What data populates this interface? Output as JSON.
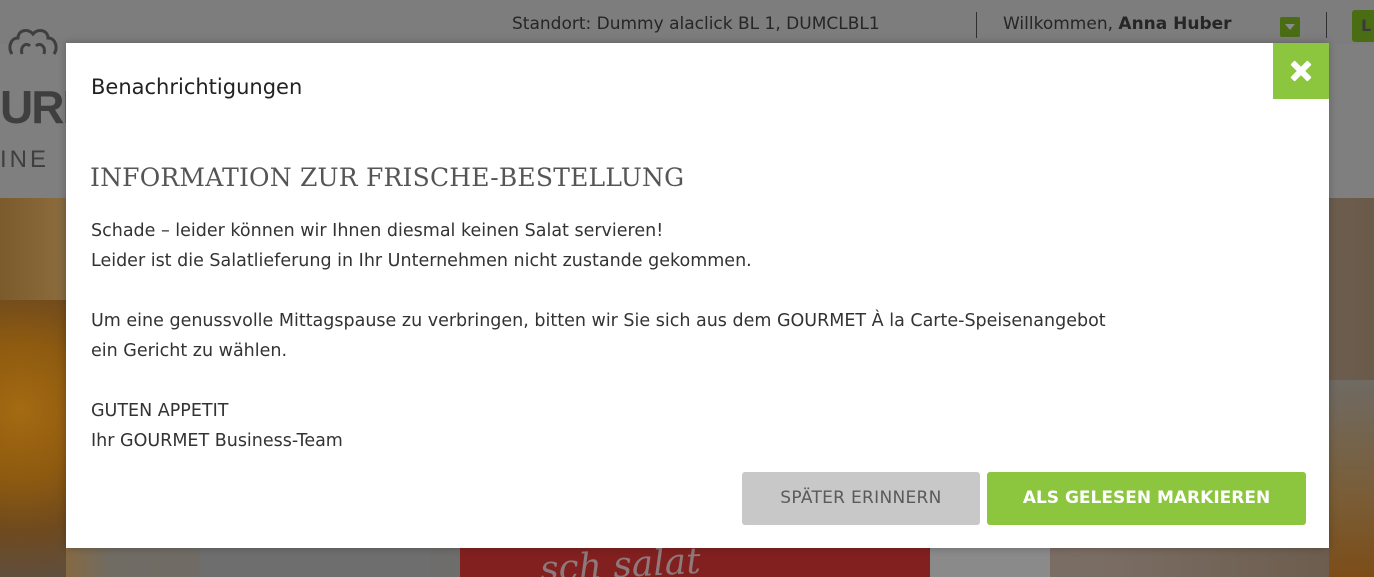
{
  "header": {
    "location": "Standort: Dummy alaclick BL 1, DUMCLBL1",
    "welcome_prefix": "Willkommen, ",
    "user_name": "Anna Huber",
    "right_button_label": "L"
  },
  "logo": {
    "line1": "URN",
    "line2": "INE"
  },
  "background": {
    "hero_text": "sch salat"
  },
  "modal": {
    "title": "Benachrichtigungen",
    "heading": "INFORMATION ZUR FRISCHE-BESTELLUNG",
    "paragraph1": [
      "Schade – leider können wir Ihnen diesmal keinen Salat servieren!",
      "Leider ist die Salatlieferung in Ihr Unternehmen nicht zustande gekommen."
    ],
    "paragraph2": [
      "Um eine genussvolle Mittagspause zu verbringen, bitten wir Sie sich aus dem GOURMET À la Carte-Speisenangebot",
      "ein Gericht zu wählen."
    ],
    "paragraph3": [
      "GUTEN APPETIT",
      "Ihr GOURMET Business-Team"
    ],
    "later_button": "SPÄTER ERINNERN",
    "read_button": "ALS GELESEN MARKIEREN"
  },
  "colors": {
    "accent_green": "#8cc63f",
    "button_grey": "#c8c8c8",
    "overlay_dim": "#7f7f7f"
  },
  "icons": {
    "close": "close-icon",
    "user_dropdown": "chevron-down-icon",
    "logo": "chef-hat-icon"
  }
}
